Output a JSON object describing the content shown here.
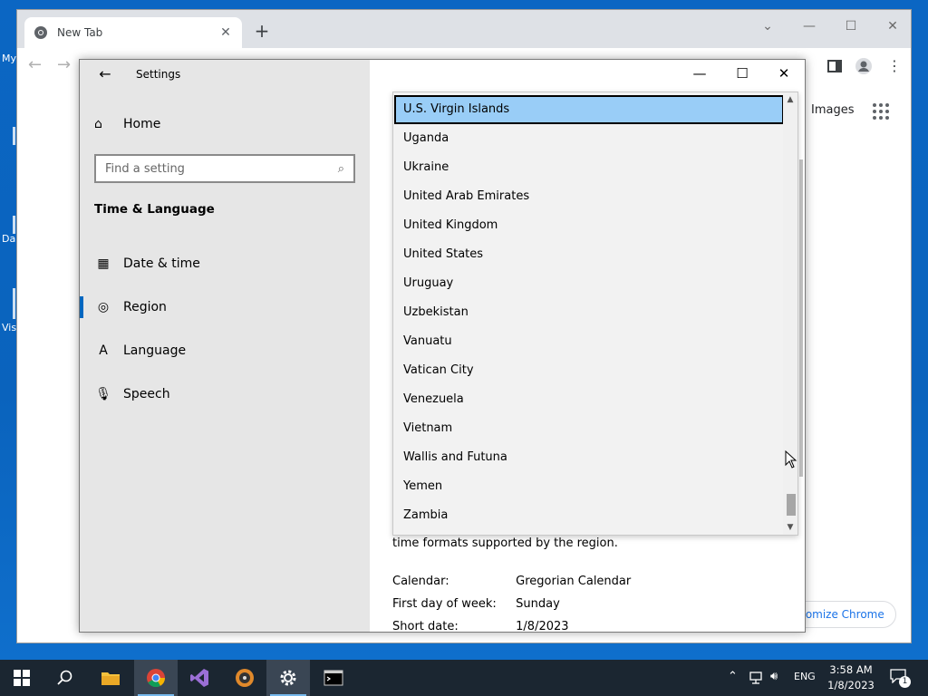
{
  "desktop": {
    "labels": [
      "My",
      "Da",
      "Vis"
    ]
  },
  "chrome": {
    "tab_title": "New Tab",
    "images_link": "Images",
    "customize_label": "ustomize Chrome"
  },
  "settings": {
    "title": "Settings",
    "home_label": "Home",
    "search_placeholder": "Find a setting",
    "section_title": "Time & Language",
    "nav": [
      {
        "label": "Date & time"
      },
      {
        "label": "Region"
      },
      {
        "label": "Language"
      },
      {
        "label": "Speech"
      }
    ],
    "content_text": "time formats supported by the region.",
    "formats": [
      {
        "key": "Calendar:",
        "value": "Gregorian Calendar"
      },
      {
        "key": "First day of week:",
        "value": "Sunday"
      },
      {
        "key": "Short date:",
        "value": "1/8/2023"
      }
    ],
    "dropdown": {
      "selected": "U.S. Virgin Islands",
      "options": [
        "U.S. Virgin Islands",
        "Uganda",
        "Ukraine",
        "United Arab Emirates",
        "United Kingdom",
        "United States",
        "Uruguay",
        "Uzbekistan",
        "Vanuatu",
        "Vatican City",
        "Venezuela",
        "Vietnam",
        "Wallis and Futuna",
        "Yemen",
        "Zambia"
      ]
    }
  },
  "taskbar": {
    "lang": "ENG",
    "time": "3:58 AM",
    "date": "1/8/2023",
    "notification_count": "1"
  },
  "colors": {
    "accent": "#0067c0",
    "selection": "#99cdf7",
    "taskbar": "#1b2631",
    "desktop": "#0b66c3"
  }
}
